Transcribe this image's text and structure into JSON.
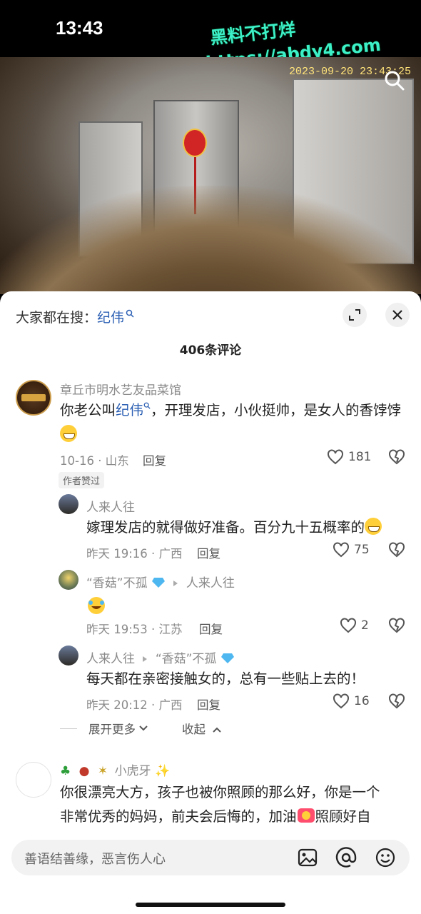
{
  "status_bar": {
    "time": "13:43"
  },
  "watermark": {
    "line1": "黑料不打烊",
    "line2": "https://abdy4.com"
  },
  "video": {
    "timestamp": "2023-09-20  23:43:25"
  },
  "panel": {
    "hot_search_prefix": "大家都在搜：",
    "hot_search_keyword": "纪伟",
    "comment_count": "406条评论"
  },
  "comments": [
    {
      "user": "章丘市明水艺友品菜馆",
      "text_before": "你老公叫",
      "link": "纪伟",
      "text_after": "，开理发店，小伙挺帅，是女人的香饽饽",
      "date": "10-16 · 山东",
      "reply_label": "回复",
      "likes": "181",
      "author_tag": "作者赞过"
    }
  ],
  "replies": [
    {
      "user": "人来人往",
      "text": "嫁理发店的就得做好准备。百分九十五概率的",
      "date": "昨天 19:16 · 广西",
      "reply_label": "回复",
      "likes": "75"
    },
    {
      "user": "“香菇”不孤",
      "reply_to": "人来人往",
      "text": "",
      "date": "昨天 19:53 · 江苏",
      "reply_label": "回复",
      "likes": "2"
    },
    {
      "user": "人来人往",
      "reply_to": "“香菇”不孤",
      "text": "每天都在亲密接触女的，总有一些贴上去的！",
      "date": "昨天 20:12 · 广西",
      "reply_label": "回复",
      "likes": "16"
    }
  ],
  "thread_controls": {
    "expand_more": "展开更多",
    "collapse": "收起"
  },
  "comment2": {
    "user": "小虎牙",
    "text_line1": "你很漂亮大方，孩子也被你照顾的那么好，你是一个",
    "text_line2_a": "非常优秀的妈妈，前夫会后悔的，加油",
    "text_line2_b": "照顾好自"
  },
  "input": {
    "placeholder": "善语结善缘，恶言伤人心"
  },
  "colors": {
    "link": "#2b5fb3",
    "watermark": "#3cf0c8"
  }
}
